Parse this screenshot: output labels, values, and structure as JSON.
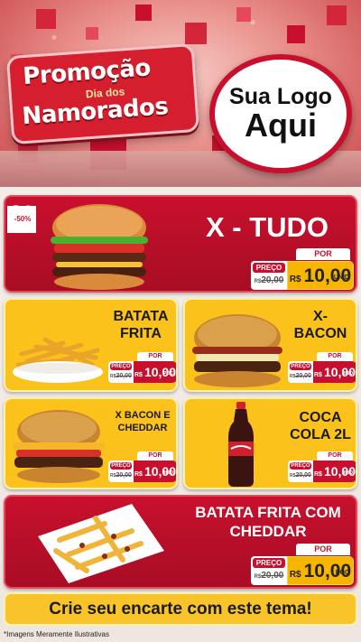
{
  "header": {
    "promo_line1": "Promoção",
    "promo_line2": "Dia dos",
    "promo_line3": "Namorados",
    "logo_line1": "Sua Logo",
    "logo_line2": "Aqui"
  },
  "colors": {
    "accent_red": "#c8102e",
    "accent_yellow": "#fbc21b",
    "price_gold": "#f7b500"
  },
  "products": [
    {
      "name": "X - TUDO",
      "badge": "-50%",
      "por_label": "POR",
      "preco_label": "PREÇO",
      "old_prefix": "R$",
      "old_price": "20,00",
      "currency": "R$",
      "price": "10,00",
      "unit": "UNID"
    },
    {
      "name_line1": "BATATA",
      "name_line2": "FRITA",
      "por_label": "POR",
      "preco_label": "PREÇO",
      "old_prefix": "R$",
      "old_price": "20,00",
      "currency": "R$",
      "price": "10,00",
      "unit": "POÇ"
    },
    {
      "name_line1": "X-",
      "name_line2": "BACON",
      "por_label": "POR",
      "preco_label": "PREÇO",
      "old_prefix": "R$",
      "old_price": "20,00",
      "currency": "R$",
      "price": "10,00",
      "unit": "UNID"
    },
    {
      "name_line1": "X BACON E",
      "name_line2": "CHEDDAR",
      "por_label": "POR",
      "preco_label": "PREÇO",
      "old_prefix": "R$",
      "old_price": "20,00",
      "currency": "R$",
      "price": "10,00",
      "unit": "UNID"
    },
    {
      "name_line1": "COCA",
      "name_line2": "COLA 2L",
      "por_label": "POR",
      "preco_label": "PREÇO",
      "old_prefix": "R$",
      "old_price": "20,00",
      "currency": "R$",
      "price": "10,00",
      "unit": "UNID"
    },
    {
      "name_line1": "BATATA FRITA COM",
      "name_line2": "CHEDDAR",
      "por_label": "POR",
      "preco_label": "PREÇO",
      "old_prefix": "R$",
      "old_price": "20,00",
      "currency": "R$",
      "price": "10,00",
      "unit": "POÇ"
    }
  ],
  "footer": {
    "cta": "Crie seu encarte com este tema!",
    "disclaimer": "*Imagens Meramente Ilustrativas"
  }
}
